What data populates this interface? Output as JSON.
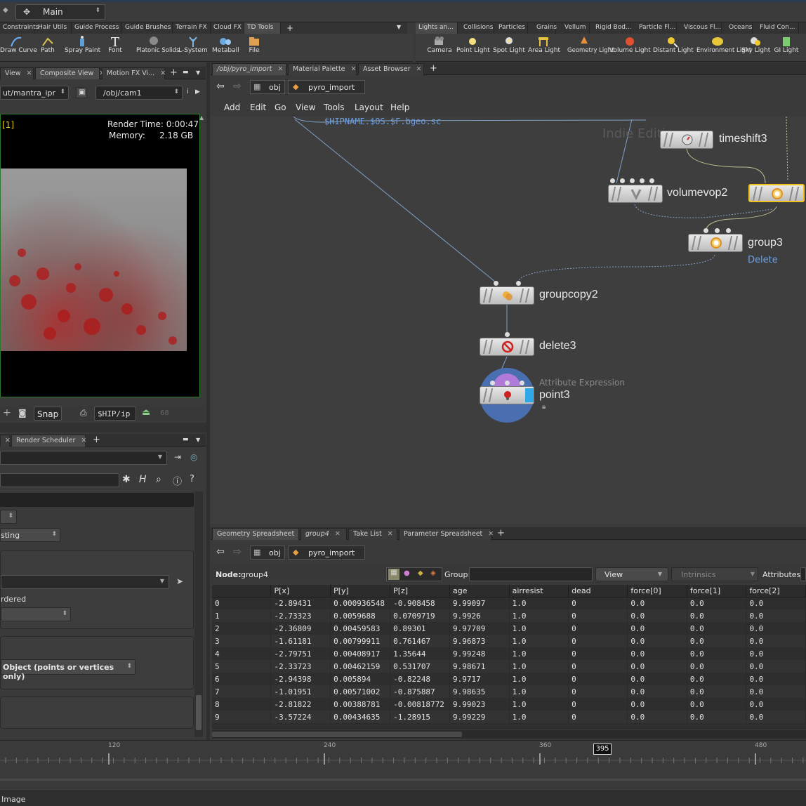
{
  "desktop": {
    "name": "Main"
  },
  "shelf": {
    "left_tabs": [
      "Constraints",
      "Hair Utils",
      "Guide Process",
      "Guide Brushes",
      "Terrain FX",
      "Cloud FX",
      "TD Tools"
    ],
    "left_tools": [
      "Draw Curve",
      "Path",
      "Spray Paint",
      "Font",
      "Platonic Solids",
      "L-System",
      "Metaball",
      "File"
    ],
    "right_tabs": [
      "Lights an...",
      "Collisions",
      "Particles",
      "Grains",
      "Vellum",
      "Rigid Bod...",
      "Particle Fl...",
      "Viscous Fl...",
      "Oceans",
      "Fluid Con..."
    ],
    "right_tools": [
      "Camera",
      "Point Light",
      "Spot Light",
      "Area Light",
      "Geometry Light",
      "Volume Light",
      "Distant Light",
      "Environment Light",
      "Sky Light",
      "GI Light"
    ]
  },
  "viewer": {
    "tabs": [
      "View",
      "Composite View",
      "Motion FX Vi..."
    ],
    "rop_path": "ut/mantra_ipr",
    "camera_path": "/obj/cam1",
    "render_index": "[1]",
    "render_time": "Render Time: 0:00:47",
    "memory_label": "Memory:",
    "memory_value": "2.18 GB",
    "snap_label": "Snap",
    "hip_path": "$HIP/ip",
    "frame_num": "68"
  },
  "params_pane": {
    "tabs": [
      "Render Scheduler"
    ],
    "field1": "sting",
    "ordered_label": "rdered",
    "class_value": "Object (points or vertices only)"
  },
  "network": {
    "tabs": [
      "/obj/pyro_import",
      "Material Palette",
      "Asset Browser"
    ],
    "path": [
      "obj",
      "pyro_import"
    ],
    "menu": [
      "Add",
      "Edit",
      "Go",
      "View",
      "Tools",
      "Layout",
      "Help"
    ],
    "watermark": "Indie Editi",
    "expr_text": "$HIPNAME.$OS.$F.bgeo.sc",
    "nodes": {
      "timeshift": "timeshift3",
      "volumevop": "volumevop2",
      "group3": "group3",
      "group3_comment": "Delete",
      "groupcopy": "groupcopy2",
      "delete": "delete3",
      "point": "point3",
      "point_comment": "Attribute Expression"
    }
  },
  "spreadsheet": {
    "tabs": [
      "Geometry Spreadsheet",
      "group4",
      "Take List",
      "Parameter Spreadsheet"
    ],
    "path": [
      "obj",
      "pyro_import"
    ],
    "node_label": "Node:",
    "node_name": "group4",
    "group_label": "Group:",
    "view_label": "View",
    "intrinsics_label": "Intrinsics",
    "attributes_label": "Attributes:",
    "columns": [
      "",
      "P[x]",
      "P[y]",
      "P[z]",
      "age",
      "airresist",
      "dead",
      "force[0]",
      "force[1]",
      "force[2]"
    ],
    "rows": [
      [
        "0",
        "-2.89431",
        "0.000936548",
        "-0.908458",
        "9.99097",
        "1.0",
        "0",
        "0.0",
        "0.0",
        "0.0"
      ],
      [
        "1",
        "-2.73323",
        "0.0059688",
        "0.0709719",
        "9.9926",
        "1.0",
        "0",
        "0.0",
        "0.0",
        "0.0"
      ],
      [
        "2",
        "-2.36809",
        "0.00459583",
        "0.89301",
        "9.97709",
        "1.0",
        "0",
        "0.0",
        "0.0",
        "0.0"
      ],
      [
        "3",
        "-1.61181",
        "0.00799911",
        "0.761467",
        "9.96873",
        "1.0",
        "0",
        "0.0",
        "0.0",
        "0.0"
      ],
      [
        "4",
        "-2.79751",
        "0.00408917",
        "1.35644",
        "9.99248",
        "1.0",
        "0",
        "0.0",
        "0.0",
        "0.0"
      ],
      [
        "5",
        "-2.33723",
        "0.00462159",
        "0.531707",
        "9.98671",
        "1.0",
        "0",
        "0.0",
        "0.0",
        "0.0"
      ],
      [
        "6",
        "-2.94398",
        "0.005894",
        "-0.82248",
        "9.9717",
        "1.0",
        "0",
        "0.0",
        "0.0",
        "0.0"
      ],
      [
        "7",
        "-1.01951",
        "0.00571002",
        "-0.875887",
        "9.98635",
        "1.0",
        "0",
        "0.0",
        "0.0",
        "0.0"
      ],
      [
        "8",
        "-2.81822",
        "0.00388781",
        "-0.00818772",
        "9.99023",
        "1.0",
        "0",
        "0.0",
        "0.0",
        "0.0"
      ],
      [
        "9",
        "-3.57224",
        "0.00434635",
        "-1.28915",
        "9.99229",
        "1.0",
        "0",
        "0.0",
        "0.0",
        "0.0"
      ]
    ]
  },
  "timeline": {
    "ticks": [
      "120",
      "240",
      "360",
      "480"
    ],
    "current_frame": "395"
  },
  "status": {
    "text": "Image"
  },
  "colors": {
    "accent": "#f0c419",
    "wire": "#7fa0c8",
    "comment_blue": "#6fa0e0",
    "render_green": "#2b7a2b"
  }
}
